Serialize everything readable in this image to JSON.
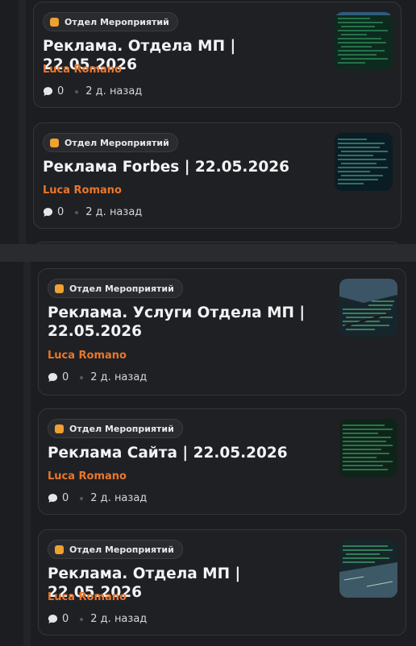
{
  "cards": [
    {
      "tag": "Отдел Мероприятий",
      "title": "Реклама. Отдела МП | 22.05.2026",
      "author": "Luca Romano",
      "comments": "0",
      "time": "2 д. назад"
    },
    {
      "tag": "Отдел Мероприятий",
      "title": "Реклама Forbes | 22.05.2026",
      "author": "Luca Romano",
      "comments": "0",
      "time": "2 д. назад"
    },
    {
      "tag": "Отдел Мероприятий",
      "title": "Реклама. Услуги Отдела МП | 22.05.2026",
      "author": "Luca Romano",
      "comments": "0",
      "time": "2 д. назад"
    },
    {
      "tag": "Отдел Мероприятий",
      "title": "Реклама Сайта | 22.05.2026",
      "author": "Luca Romano",
      "comments": "0",
      "time": "2 д. назад"
    },
    {
      "tag": "Отдел Мероприятий",
      "title": "Реклама. Отдела МП | 22.05.2026",
      "author": "Luca Romano",
      "comments": "0",
      "time": "2 д. назад"
    }
  ],
  "icons": {
    "tag": "folder-icon",
    "comments": "comment-bubble-icon",
    "thumbnail": "code-screenshot-thumbnail"
  },
  "colors": {
    "accent_tag": "#f0a131",
    "author": "#e8772d",
    "card_bg": "#1f2023",
    "page_bg": "#1a1b1e"
  }
}
